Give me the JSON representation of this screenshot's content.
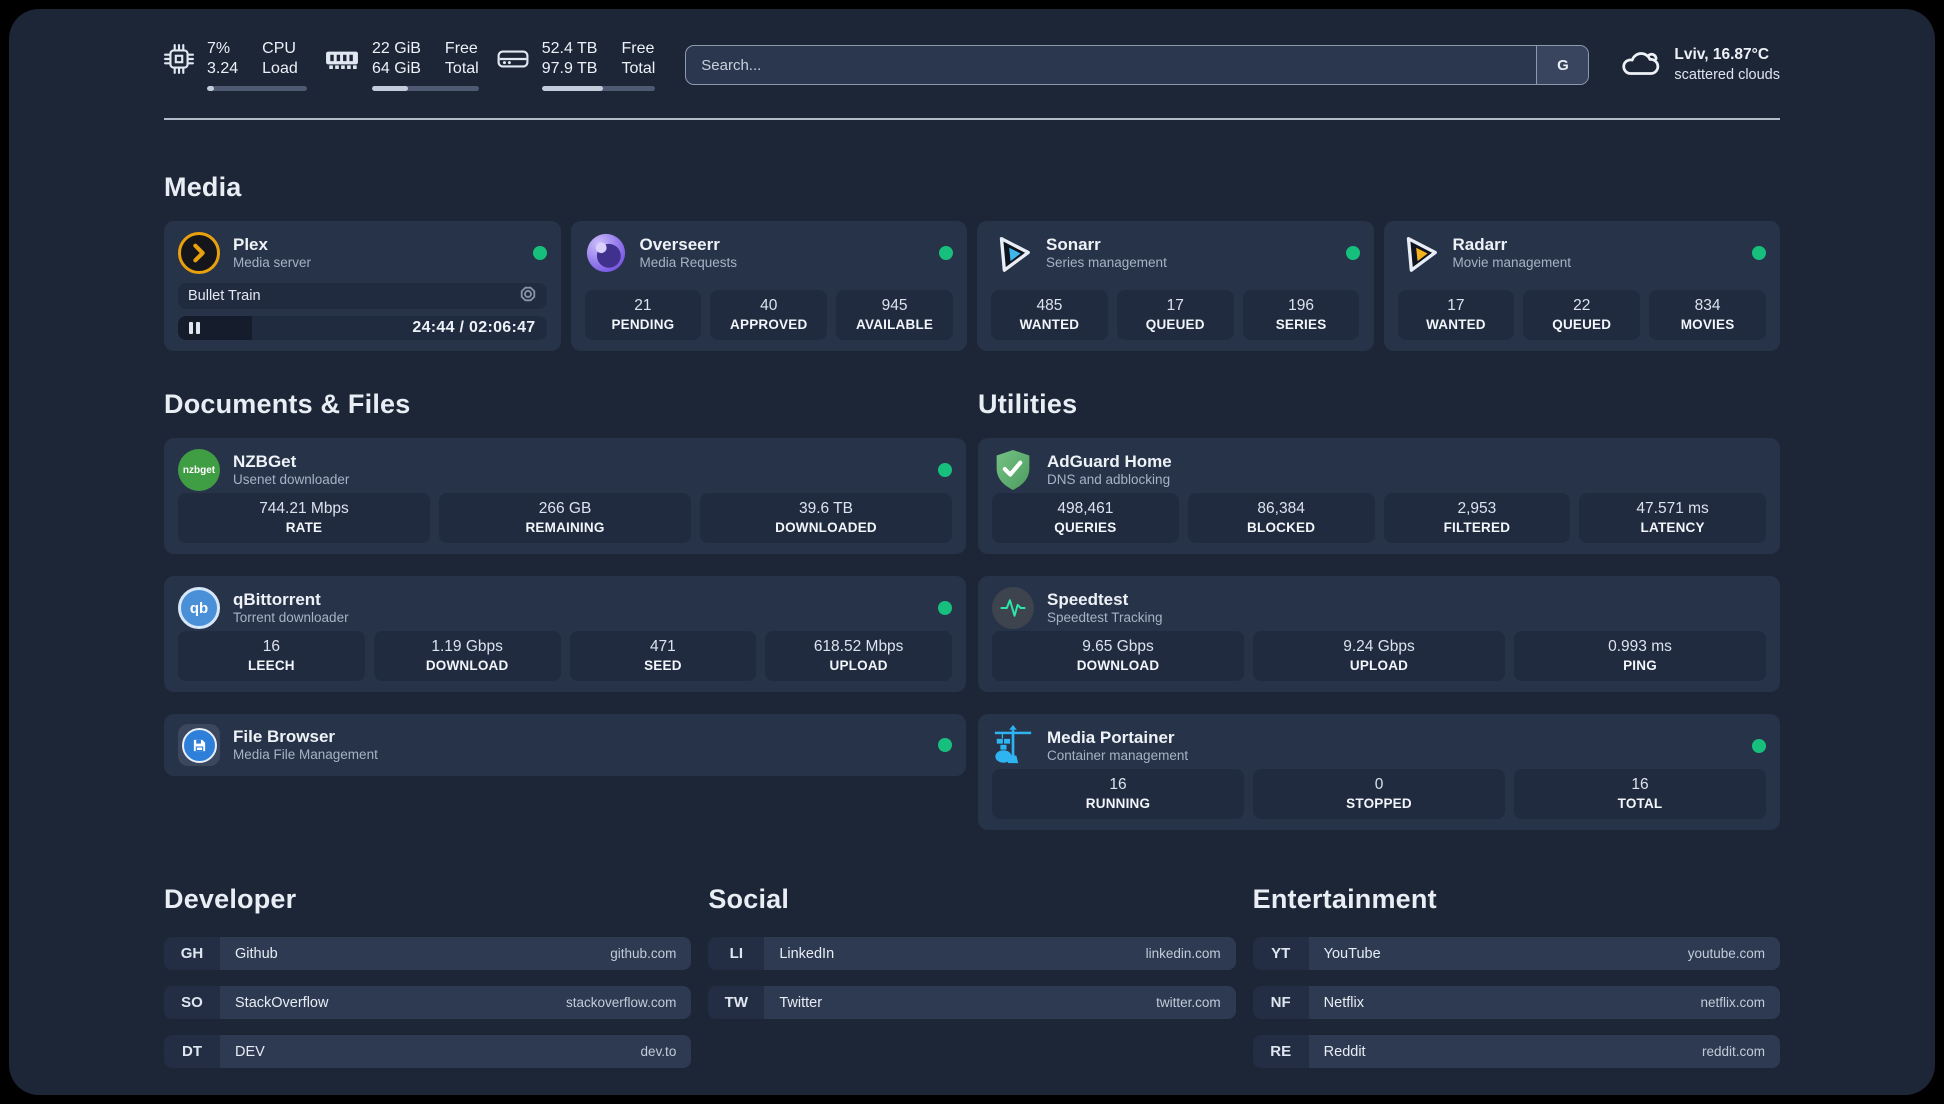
{
  "colors": {
    "page_bg": "#1d2637",
    "card_bg": "#273349",
    "stat_bg": "#202b3f",
    "online_green": "#17bf7c",
    "plex_amber": "#e8a00c"
  },
  "header": {
    "metrics": [
      {
        "icon": "cpu-chip-icon",
        "value_top": "7%",
        "value_bottom": "3.24",
        "label_top": "CPU",
        "label_bottom": "Load",
        "progress_pct": 7
      },
      {
        "icon": "memory-icon",
        "value_top": "22 GiB",
        "value_bottom": "64 GiB",
        "label_top": "Free",
        "label_bottom": "Total",
        "progress_pct": 34
      },
      {
        "icon": "disk-icon",
        "value_top": "52.4 TB",
        "value_bottom": "97.9 TB",
        "label_top": "Free",
        "label_bottom": "Total",
        "progress_pct": 54
      }
    ],
    "search": {
      "placeholder": "Search...",
      "engine_label": "G"
    },
    "weather": {
      "icon": "cloud-icon",
      "location": "Lviv, 16.87°C",
      "condition": "scattered clouds"
    }
  },
  "sections": {
    "media": {
      "title": "Media",
      "cards": [
        {
          "icon": "plex-icon",
          "name": "Plex",
          "subtitle": "Media server",
          "online": true,
          "now_playing": {
            "title": "Bullet Train",
            "time": "24:44 / 02:06:47",
            "progress_pct": 20
          }
        },
        {
          "icon": "overseerr-icon",
          "name": "Overseerr",
          "subtitle": "Media Requests",
          "online": true,
          "stats": [
            {
              "value": "21",
              "label": "PENDING"
            },
            {
              "value": "40",
              "label": "APPROVED"
            },
            {
              "value": "945",
              "label": "AVAILABLE"
            }
          ]
        },
        {
          "icon": "sonarr-icon",
          "name": "Sonarr",
          "subtitle": "Series management",
          "online": true,
          "stats": [
            {
              "value": "485",
              "label": "WANTED"
            },
            {
              "value": "17",
              "label": "QUEUED"
            },
            {
              "value": "196",
              "label": "SERIES"
            }
          ]
        },
        {
          "icon": "radarr-icon",
          "name": "Radarr",
          "subtitle": "Movie management",
          "online": true,
          "stats": [
            {
              "value": "17",
              "label": "WANTED"
            },
            {
              "value": "22",
              "label": "QUEUED"
            },
            {
              "value": "834",
              "label": "MOVIES"
            }
          ]
        }
      ]
    },
    "documents": {
      "title": "Documents & Files",
      "cards": [
        {
          "icon": "nzbget-icon",
          "name": "NZBGet",
          "subtitle": "Usenet downloader",
          "online": true,
          "stats": [
            {
              "value": "744.21 Mbps",
              "label": "RATE"
            },
            {
              "value": "266 GB",
              "label": "REMAINING"
            },
            {
              "value": "39.6 TB",
              "label": "DOWNLOADED"
            }
          ]
        },
        {
          "icon": "qbittorrent-icon",
          "name": "qBittorrent",
          "subtitle": "Torrent downloader",
          "online": true,
          "stats": [
            {
              "value": "16",
              "label": "LEECH"
            },
            {
              "value": "1.19 Gbps",
              "label": "DOWNLOAD"
            },
            {
              "value": "471",
              "label": "SEED"
            },
            {
              "value": "618.52 Mbps",
              "label": "UPLOAD"
            }
          ]
        },
        {
          "icon": "filebrowser-icon",
          "name": "File Browser",
          "subtitle": "Media File Management",
          "online": true
        }
      ]
    },
    "utilities": {
      "title": "Utilities",
      "cards": [
        {
          "icon": "adguard-icon",
          "name": "AdGuard Home",
          "subtitle": "DNS and adblocking",
          "online": false,
          "stats": [
            {
              "value": "498,461",
              "label": "QUERIES"
            },
            {
              "value": "86,384",
              "label": "BLOCKED"
            },
            {
              "value": "2,953",
              "label": "FILTERED"
            },
            {
              "value": "47.571 ms",
              "label": "LATENCY"
            }
          ]
        },
        {
          "icon": "speedtest-icon",
          "name": "Speedtest",
          "subtitle": "Speedtest Tracking",
          "online": false,
          "stats": [
            {
              "value": "9.65 Gbps",
              "label": "DOWNLOAD"
            },
            {
              "value": "9.24 Gbps",
              "label": "UPLOAD"
            },
            {
              "value": "0.993 ms",
              "label": "PING"
            }
          ]
        },
        {
          "icon": "portainer-icon",
          "name": "Media Portainer",
          "subtitle": "Container management",
          "online": true,
          "stats": [
            {
              "value": "16",
              "label": "RUNNING"
            },
            {
              "value": "0",
              "label": "STOPPED"
            },
            {
              "value": "16",
              "label": "TOTAL"
            }
          ]
        }
      ]
    },
    "bookmarks": [
      {
        "title": "Developer",
        "items": [
          {
            "abbr": "GH",
            "name": "Github",
            "url": "github.com"
          },
          {
            "abbr": "SO",
            "name": "StackOverflow",
            "url": "stackoverflow.com"
          },
          {
            "abbr": "DT",
            "name": "DEV",
            "url": "dev.to"
          }
        ]
      },
      {
        "title": "Social",
        "items": [
          {
            "abbr": "LI",
            "name": "LinkedIn",
            "url": "linkedin.com"
          },
          {
            "abbr": "TW",
            "name": "Twitter",
            "url": "twitter.com"
          }
        ]
      },
      {
        "title": "Entertainment",
        "items": [
          {
            "abbr": "YT",
            "name": "YouTube",
            "url": "youtube.com"
          },
          {
            "abbr": "NF",
            "name": "Netflix",
            "url": "netflix.com"
          },
          {
            "abbr": "RE",
            "name": "Reddit",
            "url": "reddit.com"
          }
        ]
      }
    ]
  }
}
